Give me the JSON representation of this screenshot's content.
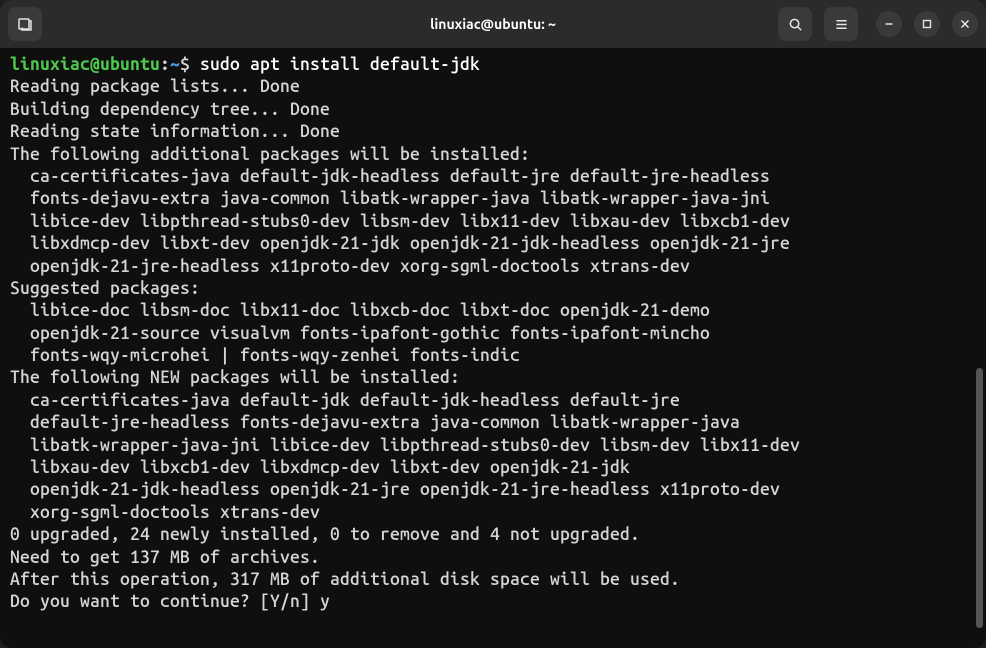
{
  "titlebar": {
    "title": "linuxiac@ubuntu: ~",
    "newTabIcon": "new-tab-icon",
    "searchIcon": "search-icon",
    "menuIcon": "hamburger-menu-icon",
    "minimizeIcon": "minimize-icon",
    "maximizeIcon": "maximize-icon",
    "closeIcon": "close-icon"
  },
  "prompt": {
    "user": "linuxiac@ubuntu",
    "sep": ":",
    "path": "~",
    "symbol": "$ "
  },
  "command": "sudo apt install default-jdk",
  "output": {
    "l1": "Reading package lists... Done",
    "l2": "Building dependency tree... Done",
    "l3": "Reading state information... Done",
    "l4": "The following additional packages will be installed:",
    "l5": "  ca-certificates-java default-jdk-headless default-jre default-jre-headless",
    "l6": "  fonts-dejavu-extra java-common libatk-wrapper-java libatk-wrapper-java-jni",
    "l7": "  libice-dev libpthread-stubs0-dev libsm-dev libx11-dev libxau-dev libxcb1-dev",
    "l8": "  libxdmcp-dev libxt-dev openjdk-21-jdk openjdk-21-jdk-headless openjdk-21-jre",
    "l9": "  openjdk-21-jre-headless x11proto-dev xorg-sgml-doctools xtrans-dev",
    "l10": "Suggested packages:",
    "l11": "  libice-doc libsm-doc libx11-doc libxcb-doc libxt-doc openjdk-21-demo",
    "l12": "  openjdk-21-source visualvm fonts-ipafont-gothic fonts-ipafont-mincho",
    "l13": "  fonts-wqy-microhei | fonts-wqy-zenhei fonts-indic",
    "l14": "The following NEW packages will be installed:",
    "l15": "  ca-certificates-java default-jdk default-jdk-headless default-jre",
    "l16": "  default-jre-headless fonts-dejavu-extra java-common libatk-wrapper-java",
    "l17": "  libatk-wrapper-java-jni libice-dev libpthread-stubs0-dev libsm-dev libx11-dev",
    "l18": "  libxau-dev libxcb1-dev libxdmcp-dev libxt-dev openjdk-21-jdk",
    "l19": "  openjdk-21-jdk-headless openjdk-21-jre openjdk-21-jre-headless x11proto-dev",
    "l20": "  xorg-sgml-doctools xtrans-dev",
    "l21": "0 upgraded, 24 newly installed, 0 to remove and 4 not upgraded.",
    "l22": "Need to get 137 MB of archives.",
    "l23": "After this operation, 317 MB of additional disk space will be used.",
    "l24": "Do you want to continue? [Y/n] y"
  }
}
